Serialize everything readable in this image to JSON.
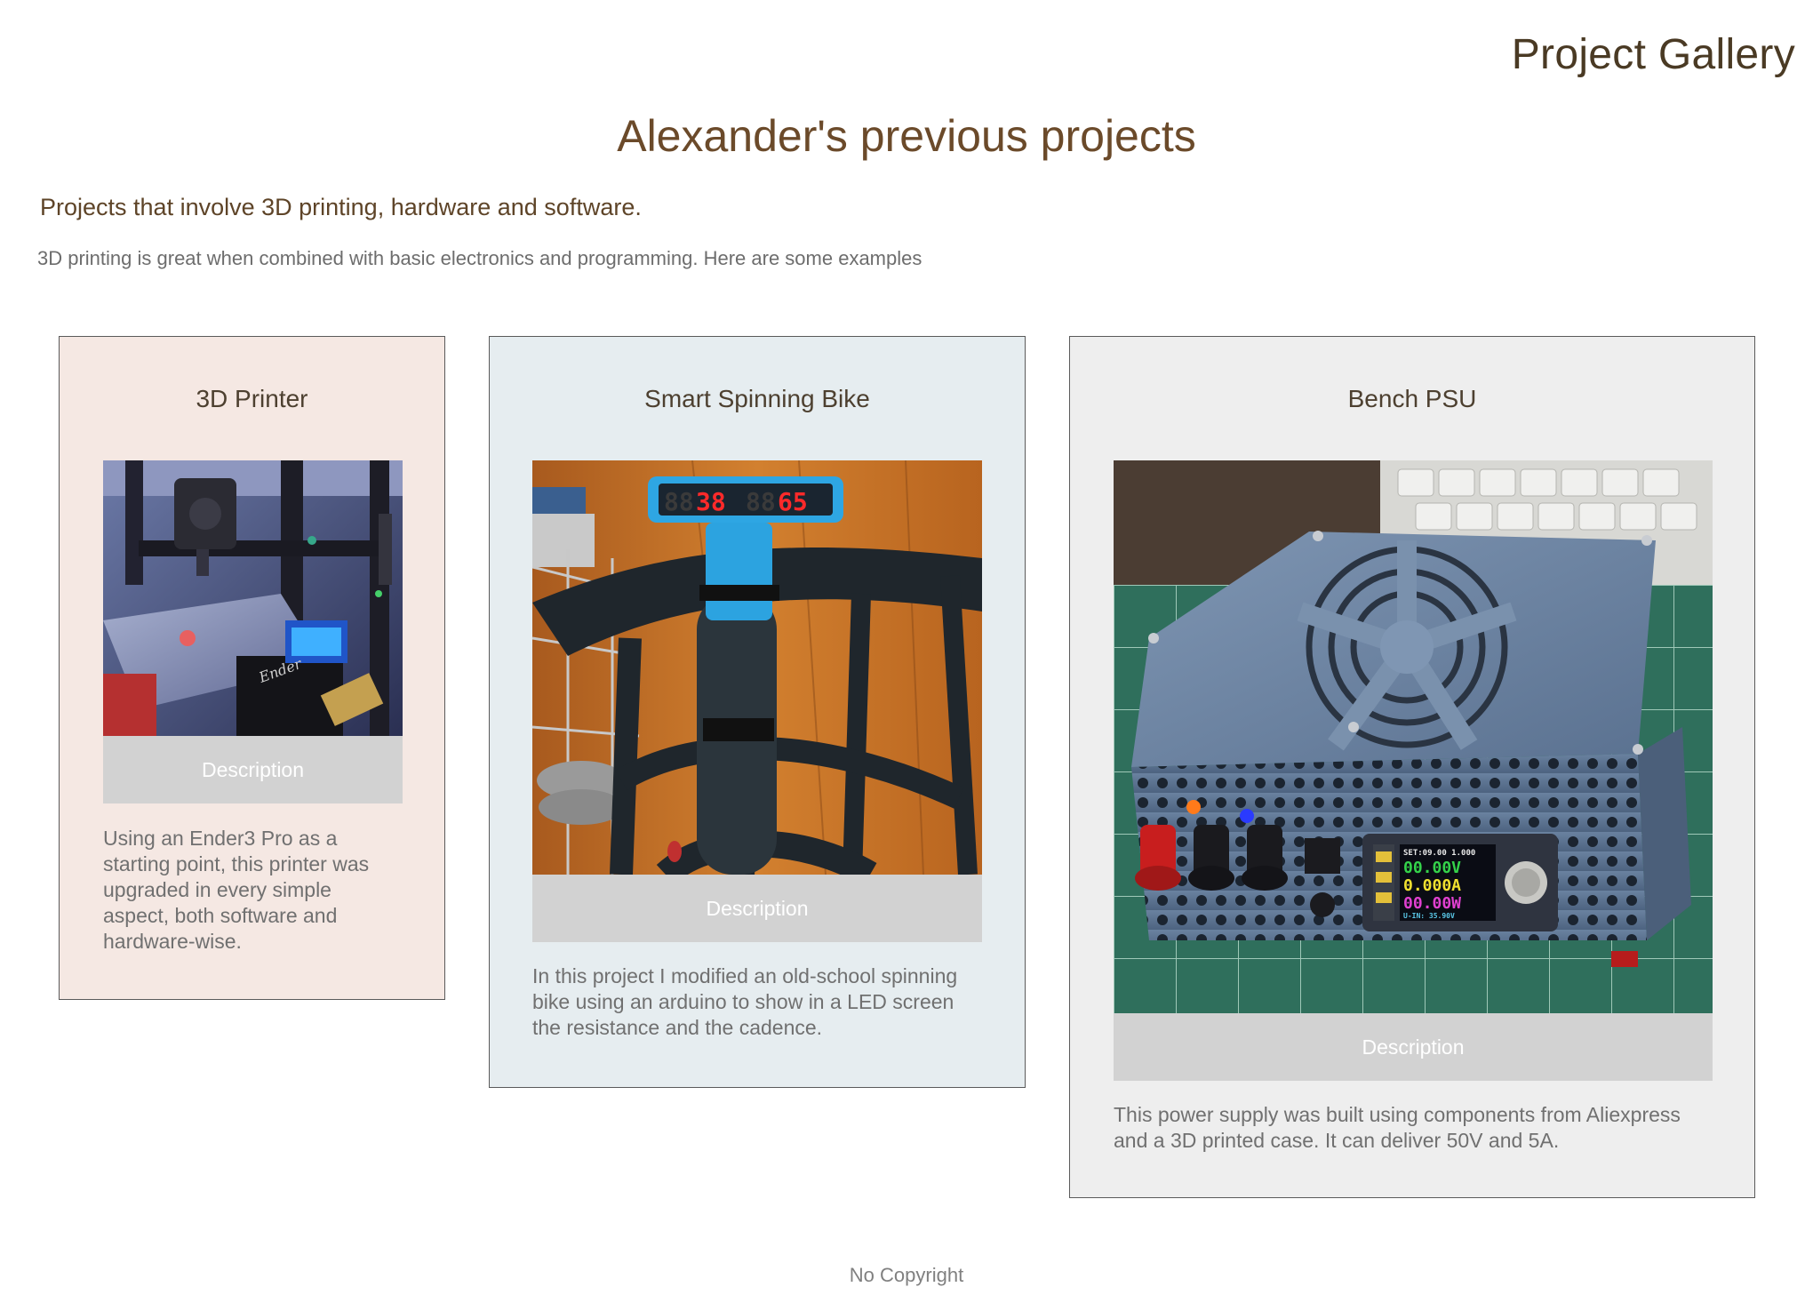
{
  "header": {
    "site_title": "Project Gallery",
    "page_heading": "Alexander's previous projects",
    "subheading": "Projects that involve 3D printing, hardware and software.",
    "intro": "3D printing is great when combined with basic electronics and programming. Here are some examples"
  },
  "projects": [
    {
      "title": "3D Printer",
      "description_label": "Description",
      "description": "Using an Ender3 Pro as a starting point, this printer was upgraded in every simple aspect, both software and hardware-wise.",
      "image_label": "Ender"
    },
    {
      "title": "Smart Spinning Bike",
      "description_label": "Description",
      "description": "In this project I modified an old-school spinning bike using an arduino to show in a LED screen the resistance and the cadence.",
      "display_value_1": "38",
      "display_value_2": "65"
    },
    {
      "title": "Bench PSU",
      "description_label": "Description",
      "description": "This power supply was built using components from Aliexpress and a 3D printed case. It can deliver 50V and 5A.",
      "lcd_line_1": "SET:09.00 1.000",
      "lcd_line_2": "00.00V",
      "lcd_line_3": "0.000A",
      "lcd_line_4": "00.00W",
      "lcd_line_5": "U-IN: 35.90V"
    }
  ],
  "footer": {
    "text": "No Copyright"
  }
}
